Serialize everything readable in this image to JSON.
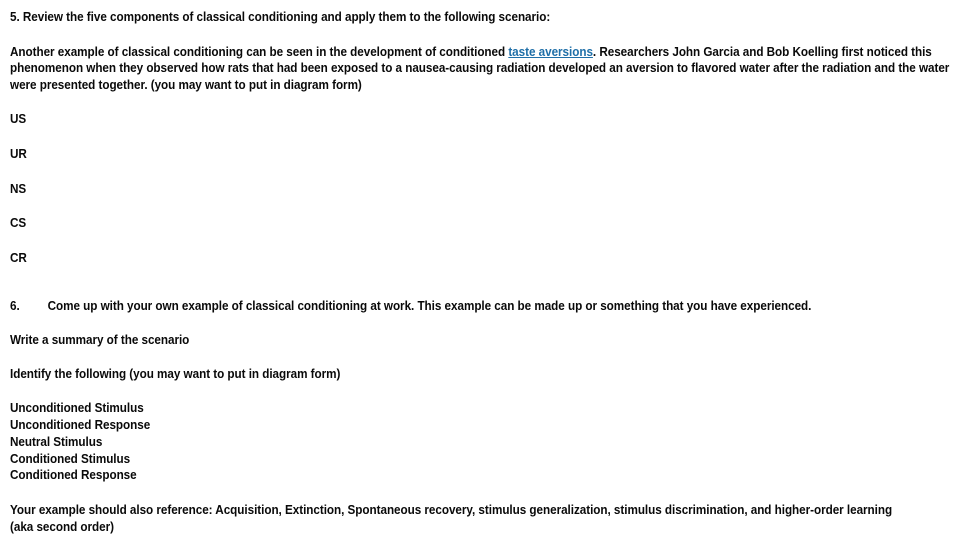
{
  "document": {
    "background_color": "#ffffff",
    "text_color": "#0a0a0a",
    "link_color": "#1f6fa8",
    "q5": {
      "heading": "5. Review the five components of classical conditioning and apply them to the following scenario:",
      "body_before_link": "Another example of classical conditioning can be seen in the development of conditioned ",
      "link_text": "taste aversions",
      "body_after_link": ". Researchers John Garcia and Bob Koelling first noticed this phenomenon when they observed how rats that had been exposed to a nausea-causing radiation developed an aversion to flavored water after the radiation and the water were presented together. (you may want to put in diagram form)",
      "components": [
        "US",
        "UR",
        "NS",
        "CS",
        "CR"
      ]
    },
    "q6": {
      "number": "6.",
      "heading": "Come up with your own example of classical conditioning at work.  This example can be made up or something that you have experienced.",
      "instruction_summary": "Write a summary of the scenario",
      "instruction_identify": "Identify the following (you may want to put in diagram form)",
      "identify_items": [
        "Unconditioned Stimulus",
        "Unconditioned Response",
        "Neutral Stimulus",
        "Conditioned Stimulus",
        "Conditioned Response"
      ],
      "reference_line_1": "Your example should also reference:  Acquisition, Extinction, Spontaneous recovery, stimulus generalization, stimulus discrimination, and higher-order learning",
      "reference_line_2": "(aka second order)"
    }
  }
}
